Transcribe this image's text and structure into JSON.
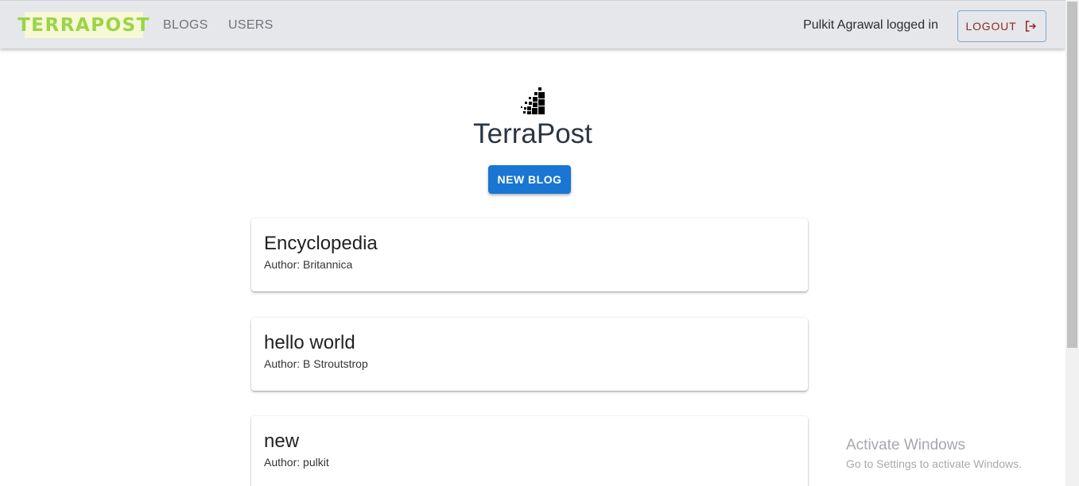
{
  "appbar": {
    "logo_text": "TERRAPOST",
    "nav": [
      {
        "label": "BLOGS"
      },
      {
        "label": "USERS"
      }
    ],
    "logged_in_text": "Pulkit Agrawal logged in",
    "logout_label": "LOGOUT",
    "logout_icon": "logout-icon"
  },
  "hero": {
    "icon": "terrapost-logo-icon",
    "title": "TerraPost",
    "new_blog_label": "NEW BLOG"
  },
  "blogs": [
    {
      "title": "Encyclopedia",
      "author": "Author: Britannica"
    },
    {
      "title": "hello world",
      "author": "Author: B Stroutstrop"
    },
    {
      "title": "new",
      "author": "Author: pulkit"
    }
  ],
  "watermark": {
    "title": "Activate Windows",
    "subtitle": "Go to Settings to activate Windows."
  },
  "colors": {
    "appbar_bg": "#e5e7ea",
    "logo_text": "#9ad447",
    "primary": "#1976d2",
    "logout_text": "#8a2a2a"
  }
}
